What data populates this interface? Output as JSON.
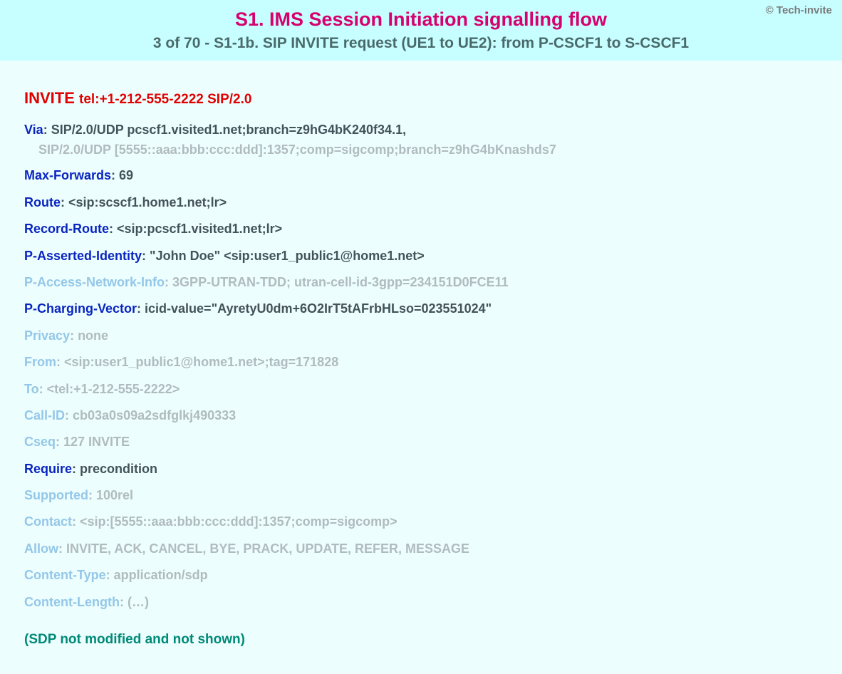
{
  "copyright": "© Tech-invite",
  "title_main": "S1. IMS Session Initiation signalling flow",
  "title_sub": "3 of 70 - S1-1b. SIP INVITE request (UE1 to UE2): from P-CSCF1 to S-CSCF1",
  "request_method": "INVITE",
  "request_uri": "tel:+1-212-555-2222 SIP/2.0",
  "headers": [
    {
      "name": "Via",
      "value": "SIP/2.0/UDP pcscf1.visited1.net;branch=z9hG4bK240f34.1,",
      "emph": "dark",
      "cont": "SIP/2.0/UDP [5555::aaa:bbb:ccc:ddd]:1357;comp=sigcomp;branch=z9hG4bKnashds7"
    },
    {
      "name": "Max-Forwards",
      "value": "69",
      "emph": "dark"
    },
    {
      "name": "Route",
      "value": "<sip:scscf1.home1.net;lr>",
      "emph": "dark"
    },
    {
      "name": "Record-Route",
      "value": "<sip:pcscf1.visited1.net;lr>",
      "emph": "dark"
    },
    {
      "name": "P-Asserted-Identity",
      "value": "\"John Doe\" <sip:user1_public1@home1.net>",
      "emph": "dark"
    },
    {
      "name": "P-Access-Network-Info",
      "value": "3GPP-UTRAN-TDD; utran-cell-id-3gpp=234151D0FCE11",
      "emph": "light"
    },
    {
      "name": "P-Charging-Vector",
      "value": "icid-value=\"AyretyU0dm+6O2IrT5tAFrbHLso=023551024\"",
      "emph": "dark"
    },
    {
      "name": "Privacy",
      "value": "none",
      "emph": "light"
    },
    {
      "name": "From",
      "value": "<sip:user1_public1@home1.net>;tag=171828",
      "emph": "light"
    },
    {
      "name": "To",
      "value": "<tel:+1-212-555-2222>",
      "emph": "light"
    },
    {
      "name": "Call-ID",
      "value": "cb03a0s09a2sdfglkj490333",
      "emph": "light"
    },
    {
      "name": "Cseq",
      "value": "127 INVITE",
      "emph": "light"
    },
    {
      "name": "Require",
      "value": "precondition",
      "emph": "dark"
    },
    {
      "name": "Supported",
      "value": "100rel",
      "emph": "light"
    },
    {
      "name": "Contact",
      "value": "<sip:[5555::aaa:bbb:ccc:ddd]:1357;comp=sigcomp>",
      "emph": "light"
    },
    {
      "name": "Allow",
      "value": "INVITE, ACK, CANCEL, BYE, PRACK, UPDATE, REFER, MESSAGE",
      "emph": "light"
    },
    {
      "name": "Content-Type",
      "value": "application/sdp",
      "emph": "light"
    },
    {
      "name": "Content-Length",
      "value": "(…)",
      "emph": "light"
    }
  ],
  "sdp_note": "(SDP not modified and not shown)"
}
